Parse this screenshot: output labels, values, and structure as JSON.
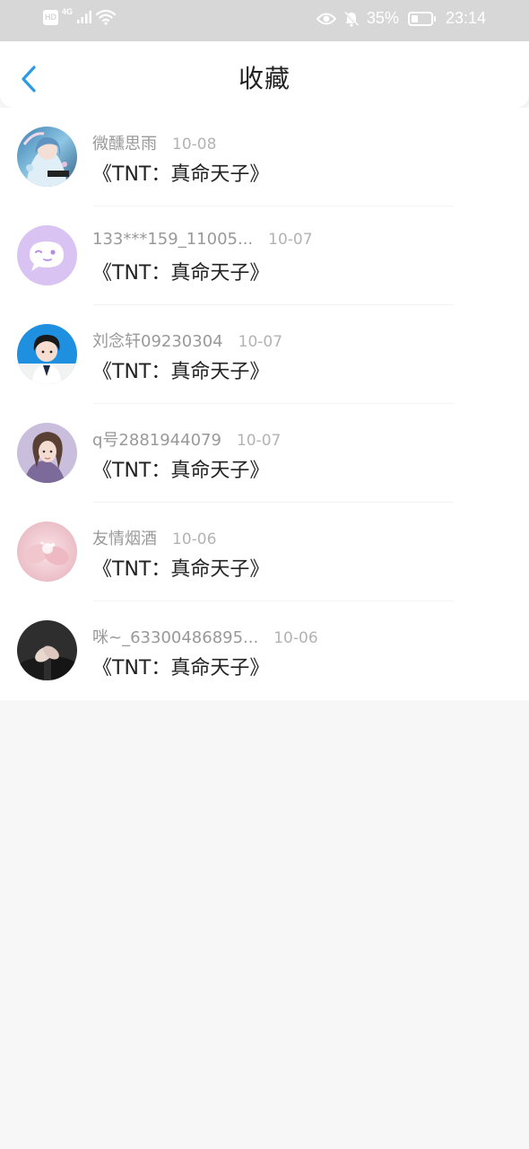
{
  "status_bar": {
    "hd": "HD",
    "network": "4G",
    "battery_text": "35%",
    "battery_level": 0.35,
    "time": "23:14"
  },
  "header": {
    "title": "收藏"
  },
  "favorites": [
    {
      "user": "微醺思雨",
      "date": "10-08",
      "title": "《TNT：真命天子》",
      "avatar": "anime-girl-avatar"
    },
    {
      "user": "133***159_11005...",
      "date": "10-07",
      "title": "《TNT：真命天子》",
      "avatar": "chat-bubble-avatar"
    },
    {
      "user": "刘念轩09230304",
      "date": "10-07",
      "title": "《TNT：真命天子》",
      "avatar": "boy-photo-avatar"
    },
    {
      "user": "q号2881944079",
      "date": "10-07",
      "title": "《TNT：真命天子》",
      "avatar": "illustrated-girl-avatar"
    },
    {
      "user": "友情烟酒",
      "date": "10-06",
      "title": "《TNT：真命天子》",
      "avatar": "pink-hands-avatar"
    },
    {
      "user": "咪~_63300486895...",
      "date": "10-06",
      "title": "《TNT：真命天子》",
      "avatar": "holding-hands-avatar"
    }
  ],
  "colors": {
    "accent": "#2b9ae8",
    "status_bar": "#d7d7d7",
    "page_background": "#f8f7f7"
  }
}
